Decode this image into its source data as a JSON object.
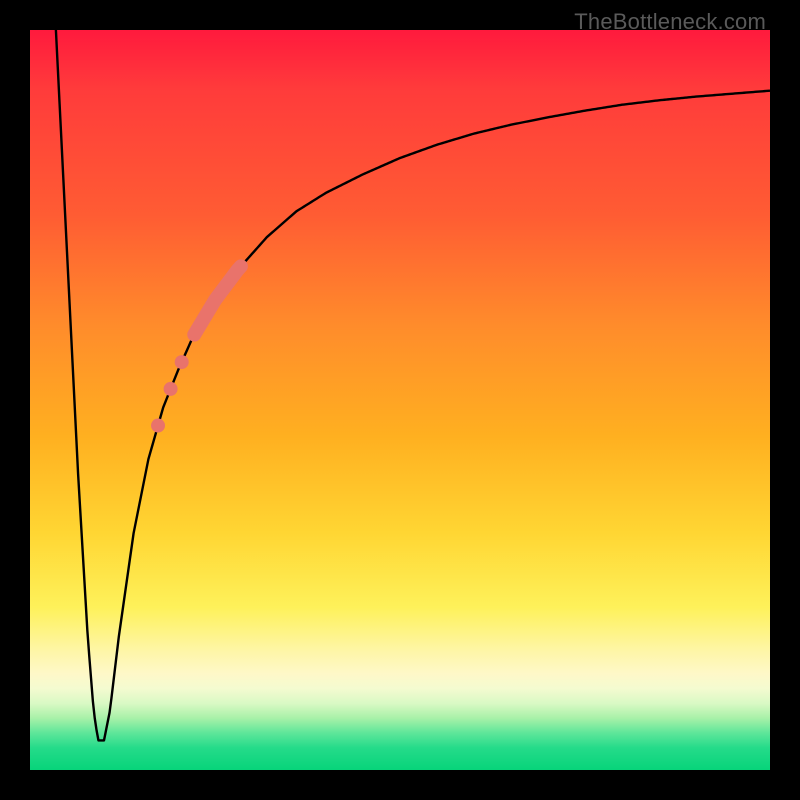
{
  "watermark": "TheBottleneck.com",
  "colors": {
    "curve": "#000000",
    "highlight": "#e9736b",
    "frame": "#000000"
  },
  "chart_data": {
    "type": "line",
    "title": "",
    "xlabel": "",
    "ylabel": "",
    "xlim": [
      0,
      100
    ],
    "ylim": [
      0,
      100
    ],
    "grid": false,
    "note": "x is normalized horizontal position (0=left edge of plot, 100=right). y is normalized 'bottleneck %' (0=bottom/green, 100=top/red). The curve starts at top-left, plunges to a narrow valley near x≈9 (y≈4), then climbs asymptotically toward y≈92 at the right edge.",
    "series": [
      {
        "name": "bottleneck-curve",
        "x": [
          3.5,
          5,
          6.5,
          7.8,
          8.6,
          9.2,
          10.0,
          10.8,
          12,
          14,
          16,
          18,
          20,
          22,
          25,
          28,
          32,
          36,
          40,
          45,
          50,
          55,
          60,
          65,
          70,
          75,
          80,
          85,
          90,
          95,
          100
        ],
        "y": [
          100,
          70,
          40,
          18,
          8,
          4,
          4,
          8,
          18,
          32,
          42,
          49,
          54,
          58.5,
          63.5,
          67.5,
          72,
          75.5,
          78,
          80.5,
          82.7,
          84.5,
          86,
          87.2,
          88.2,
          89.1,
          89.9,
          90.5,
          91,
          91.4,
          91.8
        ]
      }
    ],
    "highlight_segment": {
      "name": "salmon-thick-band",
      "x_range": [
        22.2,
        28.5
      ],
      "description": "thick rounded stroke along the curve between these x values"
    },
    "highlight_dots": {
      "name": "salmon-dots",
      "x": [
        20.5,
        19.0,
        17.3
      ],
      "radius_px": 7
    }
  }
}
